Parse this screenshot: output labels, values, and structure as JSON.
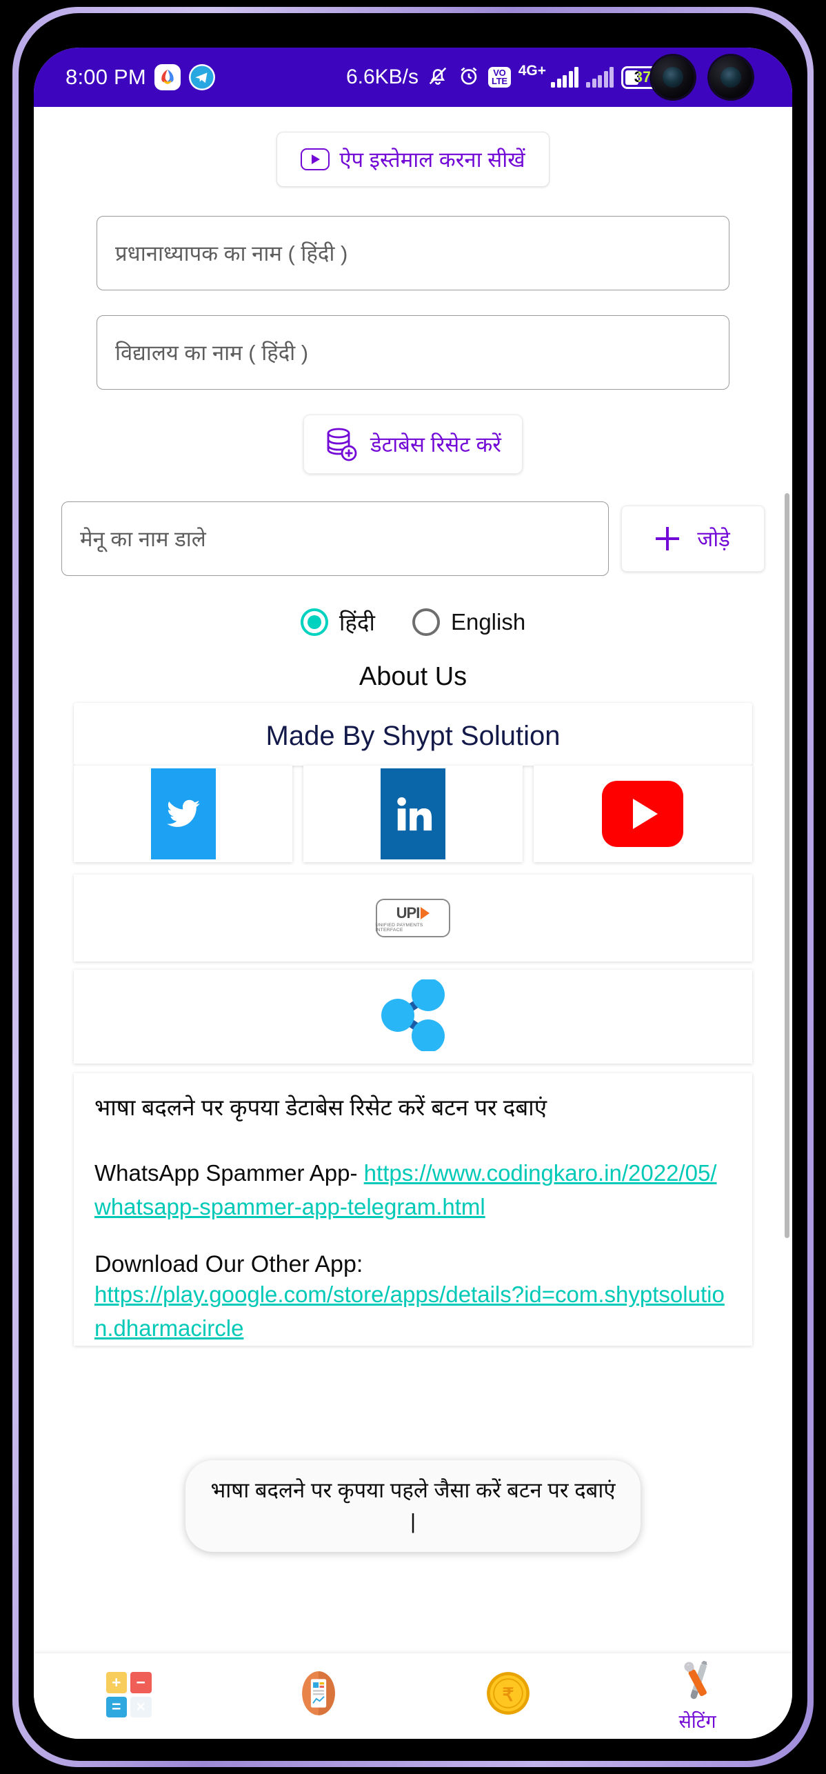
{
  "status_bar": {
    "time": "8:00 PM",
    "network_speed": "6.6KB/s",
    "network_type": "4G+",
    "volte_line1": "VO",
    "volte_line2": "LTE",
    "battery_percent": "37",
    "icons": [
      "google-pay-icon",
      "telegram-icon",
      "mute-bell-icon",
      "alarm-clock-icon",
      "volte-icon",
      "signal-bars-icon",
      "signal-bars-icon",
      "battery-icon"
    ],
    "background_color": "#3d05be"
  },
  "main": {
    "learn_button": {
      "label": "ऐप  इस्तेमाल करना सीखें",
      "icon": "play-box-icon"
    },
    "fields": [
      {
        "placeholder": "प्रधानाध्यापक का नाम ( हिंदी )"
      },
      {
        "placeholder": "विद्यालय का नाम ( हिंदी )"
      }
    ],
    "db_reset_button": {
      "label": "डेटाबेस रिसेट करें",
      "icon": "database-add-icon"
    },
    "menu_row": {
      "input_placeholder": "मेनू का नाम डाले",
      "add_label": "जोड़े",
      "add_icon": "plus-icon"
    },
    "language": {
      "options": [
        {
          "label": "हिंदी",
          "selected": true
        },
        {
          "label": "English",
          "selected": false
        }
      ],
      "selected_color": "#00d2c0"
    },
    "about_title": "About Us",
    "made_by": "Made By Shypt Solution",
    "social": [
      {
        "name": "twitter",
        "color": "#1da1f2"
      },
      {
        "name": "linkedin",
        "color": "#0a66a8"
      },
      {
        "name": "youtube",
        "color": "#ff0000"
      }
    ],
    "upi": {
      "word": "UPI",
      "subtitle": "UNIFIED PAYMENTS INTERFACE"
    },
    "share": {
      "icon": "share-nodes-icon",
      "color": "#29b6f6"
    },
    "info": {
      "notice": "भाषा बदलने पर कृपया डेटाबेस रिसेट करें बटन पर दबाएं",
      "whatsapp_label": "WhatsApp Spammer App-",
      "whatsapp_link": "https://www.codingkaro.in/2022/05/whatsapp-spammer-app-telegram.html",
      "download_label": "Download Our Other App:",
      "download_link": "https://play.google.com/store/apps/details?id=com.shyptsolution.dharmacircle",
      "link_color": "#00c9b7"
    }
  },
  "toast": {
    "message": "भाषा बदलने पर कृपया पहले जैसा करें बटन पर दबाएं |"
  },
  "bottom_nav": [
    {
      "icon": "calculator-icon",
      "label": ""
    },
    {
      "icon": "report-document-icon",
      "label": ""
    },
    {
      "icon": "rupee-coin-icon",
      "label": ""
    },
    {
      "icon": "tools-settings-icon",
      "label": "सेटिंग"
    }
  ]
}
